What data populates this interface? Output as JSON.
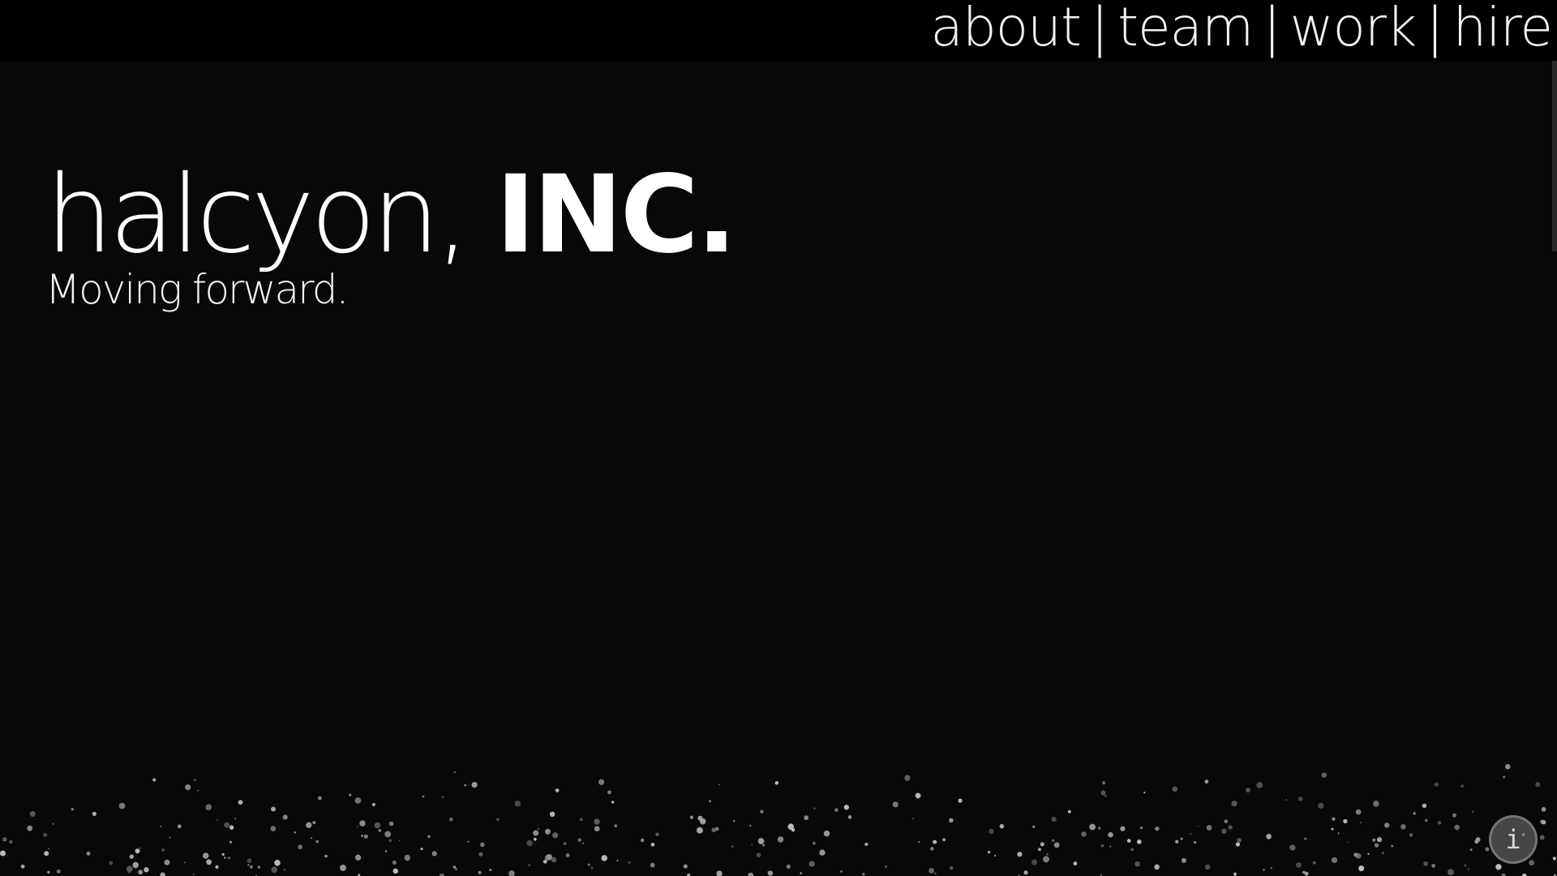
{
  "nav": {
    "items": [
      {
        "label": "about"
      },
      {
        "label": "team"
      },
      {
        "label": "work"
      },
      {
        "label": "hire"
      }
    ],
    "separator": "|"
  },
  "hero": {
    "title_light": "halcyon,",
    "title_bold": "INC.",
    "subtitle": "Moving forward."
  },
  "info_button": {
    "icon": "info-icon",
    "glyph": "i"
  },
  "colors": {
    "background": "#080808",
    "topbar": "#000000",
    "text": "#ffffff"
  }
}
